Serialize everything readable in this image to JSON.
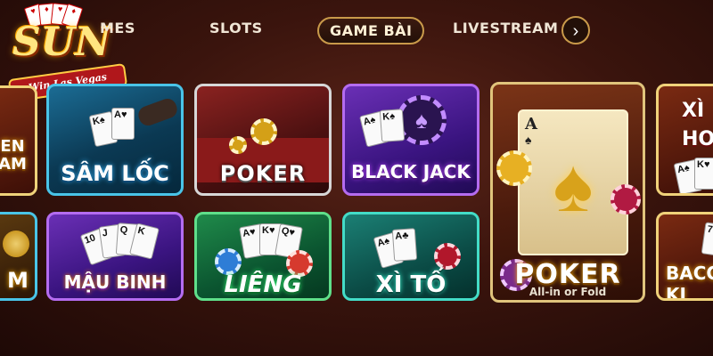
{
  "logo": {
    "text": "SUN",
    "ribbon": "Win Las Vegas"
  },
  "nav": {
    "items": [
      {
        "label": "MES"
      },
      {
        "label": "SLOTS"
      },
      {
        "label": "GAME BÀI",
        "active": true
      },
      {
        "label": "LIVESTREAM"
      }
    ],
    "next_icon": "chevron-right-icon"
  },
  "tiles": {
    "partial_left_top": "EN\nAM",
    "sam_loc": "SÂM LỐC",
    "poker": "POKER",
    "black_jack": "BLACK JACK",
    "poker_big": "POKER",
    "poker_big_sub": "All-in or Fold",
    "partial_left_bottom": "M",
    "mau_binh": "MẬU BINH",
    "lieng": "LIÊNG",
    "xi_to": "XÌ TỐ",
    "partial_right_top": "XÌ\nHO",
    "partial_right_bottom": "BACC\nKI"
  },
  "colors": {
    "accent_gold": "#c99a4a",
    "background": "#3a140d"
  }
}
